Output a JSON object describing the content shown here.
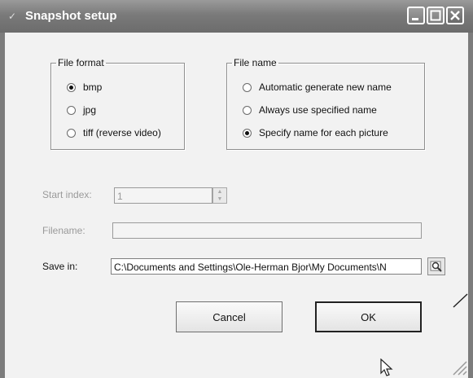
{
  "window": {
    "title": "Snapshot setup",
    "icon": "snapshot-icon",
    "controls": [
      "minimize-icon",
      "maximize-icon",
      "close-icon"
    ]
  },
  "file_format": {
    "legend": "File format",
    "options": [
      {
        "label": "bmp",
        "checked": true
      },
      {
        "label": "jpg",
        "checked": false
      },
      {
        "label": "tiff  (reverse video)",
        "checked": false
      }
    ]
  },
  "file_name": {
    "legend": "File name",
    "options": [
      {
        "label": "Automatic generate new name",
        "checked": false
      },
      {
        "label": "Always use specified name",
        "checked": false
      },
      {
        "label": "Specify name for each picture",
        "checked": true
      }
    ]
  },
  "form": {
    "start_index_label": "Start index:",
    "start_index_value": "1",
    "filename_label": "Filename:",
    "filename_value": "",
    "save_in_label": "Save in:",
    "save_in_value": "C:\\Documents and Settings\\Ole-Herman Bjor\\My Documents\\N",
    "browse_icon": "browse-folder-icon"
  },
  "buttons": {
    "cancel": "Cancel",
    "ok": "OK"
  }
}
